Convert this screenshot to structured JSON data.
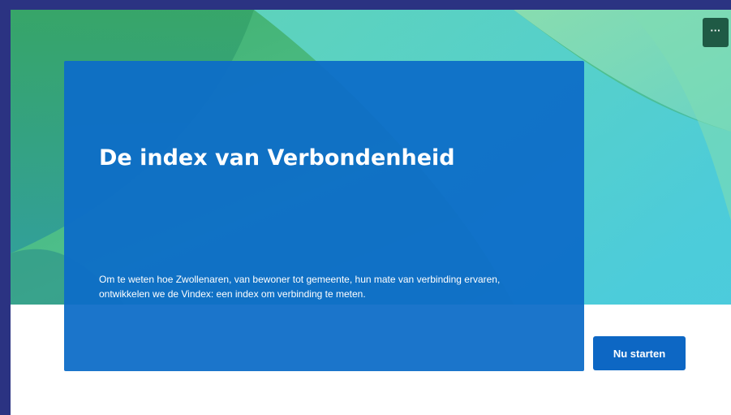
{
  "form": {
    "title": "De index van Verbondenheid",
    "description": "Om te weten hoe Zwollenaren, van bewoner tot gemeente, hun mate van verbinding ervaren, ontwikkelen we de Vindex: een index om verbinding te meten.",
    "start_label": "Nu starten",
    "more_label": "···"
  },
  "colors": {
    "page_background": "#2b3382",
    "card": "#0d6cc8",
    "button": "#0d67c4",
    "more_button": "#1f5a45",
    "hero_green": "#4fb57a",
    "hero_teal": "#5cd6d2"
  }
}
